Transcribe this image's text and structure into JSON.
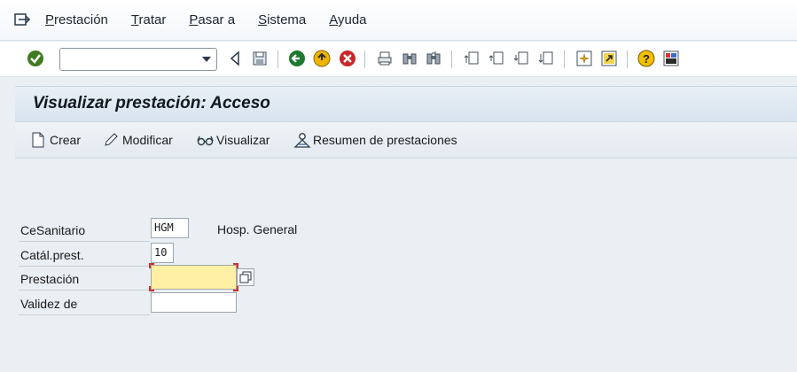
{
  "menu": {
    "items": [
      {
        "accel": "P",
        "rest": "restación"
      },
      {
        "accel": "T",
        "rest": "ratar"
      },
      {
        "accel": "P",
        "rest": "asar a"
      },
      {
        "accel": "S",
        "rest": "istema"
      },
      {
        "accel": "A",
        "rest": "yuda"
      }
    ]
  },
  "toolbar": {
    "command_value": ""
  },
  "header": {
    "title": "Visualizar prestación: Acceso"
  },
  "app_toolbar": {
    "create_label": "Crear",
    "modify_label": "Modificar",
    "display_label": "Visualizar",
    "summary_label": "Resumen de prestaciones"
  },
  "form": {
    "fields": [
      {
        "label": "CeSanitario",
        "value": "HGM",
        "description": "Hosp. General"
      },
      {
        "label": "Catál.prest.",
        "value": "10"
      },
      {
        "label": "Prestación",
        "value": ""
      },
      {
        "label": "Validez de",
        "value": ""
      }
    ]
  },
  "colors": {
    "active_field": "#fff0a6",
    "required_marker": "#d0312d",
    "title_bg": "#d7e3ee"
  }
}
